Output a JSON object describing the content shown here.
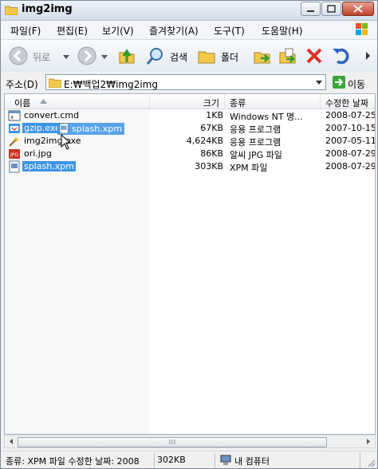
{
  "window": {
    "title": "img2img"
  },
  "menu": [
    "파일(F)",
    "편집(E)",
    "보기(V)",
    "즐겨찾기(A)",
    "도구(T)",
    "도움말(H)"
  ],
  "toolbar": {
    "back_label": "뒤로",
    "search_label": "검색",
    "folders_label": "폴더"
  },
  "address": {
    "label": "주소(D)",
    "path": "E:₩백업2₩img2img",
    "go_label": "이동"
  },
  "columns": {
    "name": "이름",
    "size": "크기",
    "type": "종류",
    "modified": "수정한 날짜"
  },
  "files": [
    {
      "name": "convert.cmd",
      "size": "1KB",
      "type": "Windows NT 명...",
      "modified": "2008-07-25",
      "icon": "cmd-script-icon"
    },
    {
      "name": "gzip.exe",
      "size": "67KB",
      "type": "응용 프로그램",
      "modified": "2007-10-15",
      "icon": "exe-icon"
    },
    {
      "name": "img2img.exe",
      "size": "4,624KB",
      "type": "응용 프로그램",
      "modified": "2007-05-11",
      "icon": "exe-icon"
    },
    {
      "name": "ori.jpg",
      "size": "86KB",
      "type": "알씨 JPG 파일",
      "modified": "2008-07-29",
      "icon": "jpg-file-icon"
    },
    {
      "name": "splash.xpm",
      "size": "303KB",
      "type": "XPM 파일",
      "modified": "2008-07-29",
      "icon": "xpm-file-icon"
    }
  ],
  "drag": {
    "label": "splash.xpm"
  },
  "status": {
    "text": "종류: XPM 파일 수정한 날짜: 2008",
    "size": "302KB",
    "location": "내 컴퓨터"
  },
  "colors": {
    "selection": "#3d95e6",
    "close_button": "#c1402a"
  }
}
